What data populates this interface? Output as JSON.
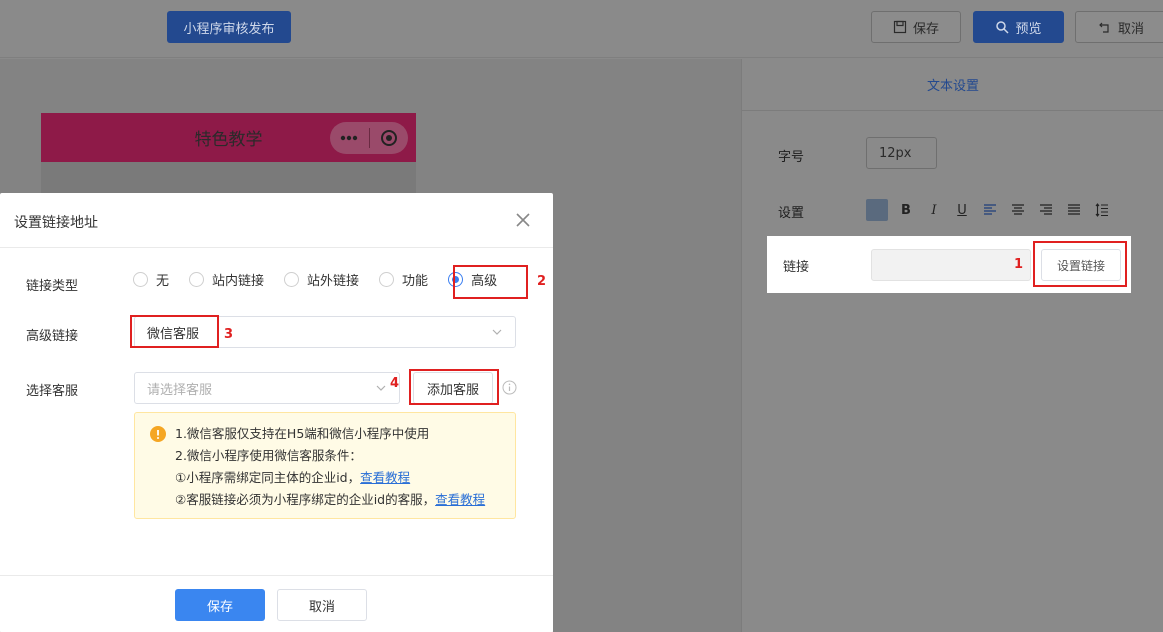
{
  "topbar": {
    "publish_label": "小程序审核发布",
    "save_label": "保存",
    "preview_label": "预览",
    "cancel_label": "取消"
  },
  "phone": {
    "title": "特色教学"
  },
  "side_panel": {
    "tab_label": "文本设置",
    "font_size_label": "字号",
    "font_size_value": "12px",
    "settings_label": "设置",
    "link_label": "链接",
    "set_link_label": "设置链接",
    "format_tools": [
      "B",
      "I",
      "U"
    ]
  },
  "steps": [
    "1",
    "2",
    "3",
    "4"
  ],
  "modal": {
    "title": "设置链接地址",
    "link_type_label": "链接类型",
    "link_types": [
      "无",
      "站内链接",
      "站外链接",
      "功能",
      "高级"
    ],
    "selected_link_type": "高级",
    "advanced_link_label": "高级链接",
    "advanced_link_value": "微信客服",
    "select_service_label": "选择客服",
    "select_service_placeholder": "请选择客服",
    "add_service_label": "添加客服",
    "notice": {
      "line1": "1.微信客服仅支持在H5端和微信小程序中使用",
      "line2": "2.微信小程序使用微信客服条件：",
      "line3": "①小程序需绑定同主体的企业id，",
      "line4": "②客服链接必须为小程序绑定的企业id的客服，",
      "link_text": "查看教程"
    },
    "save_label": "保存",
    "cancel_label": "取消"
  },
  "colors": {
    "primary": "#3a86f0",
    "highlight": "#e02020",
    "notice_bg": "#fffbe6"
  }
}
